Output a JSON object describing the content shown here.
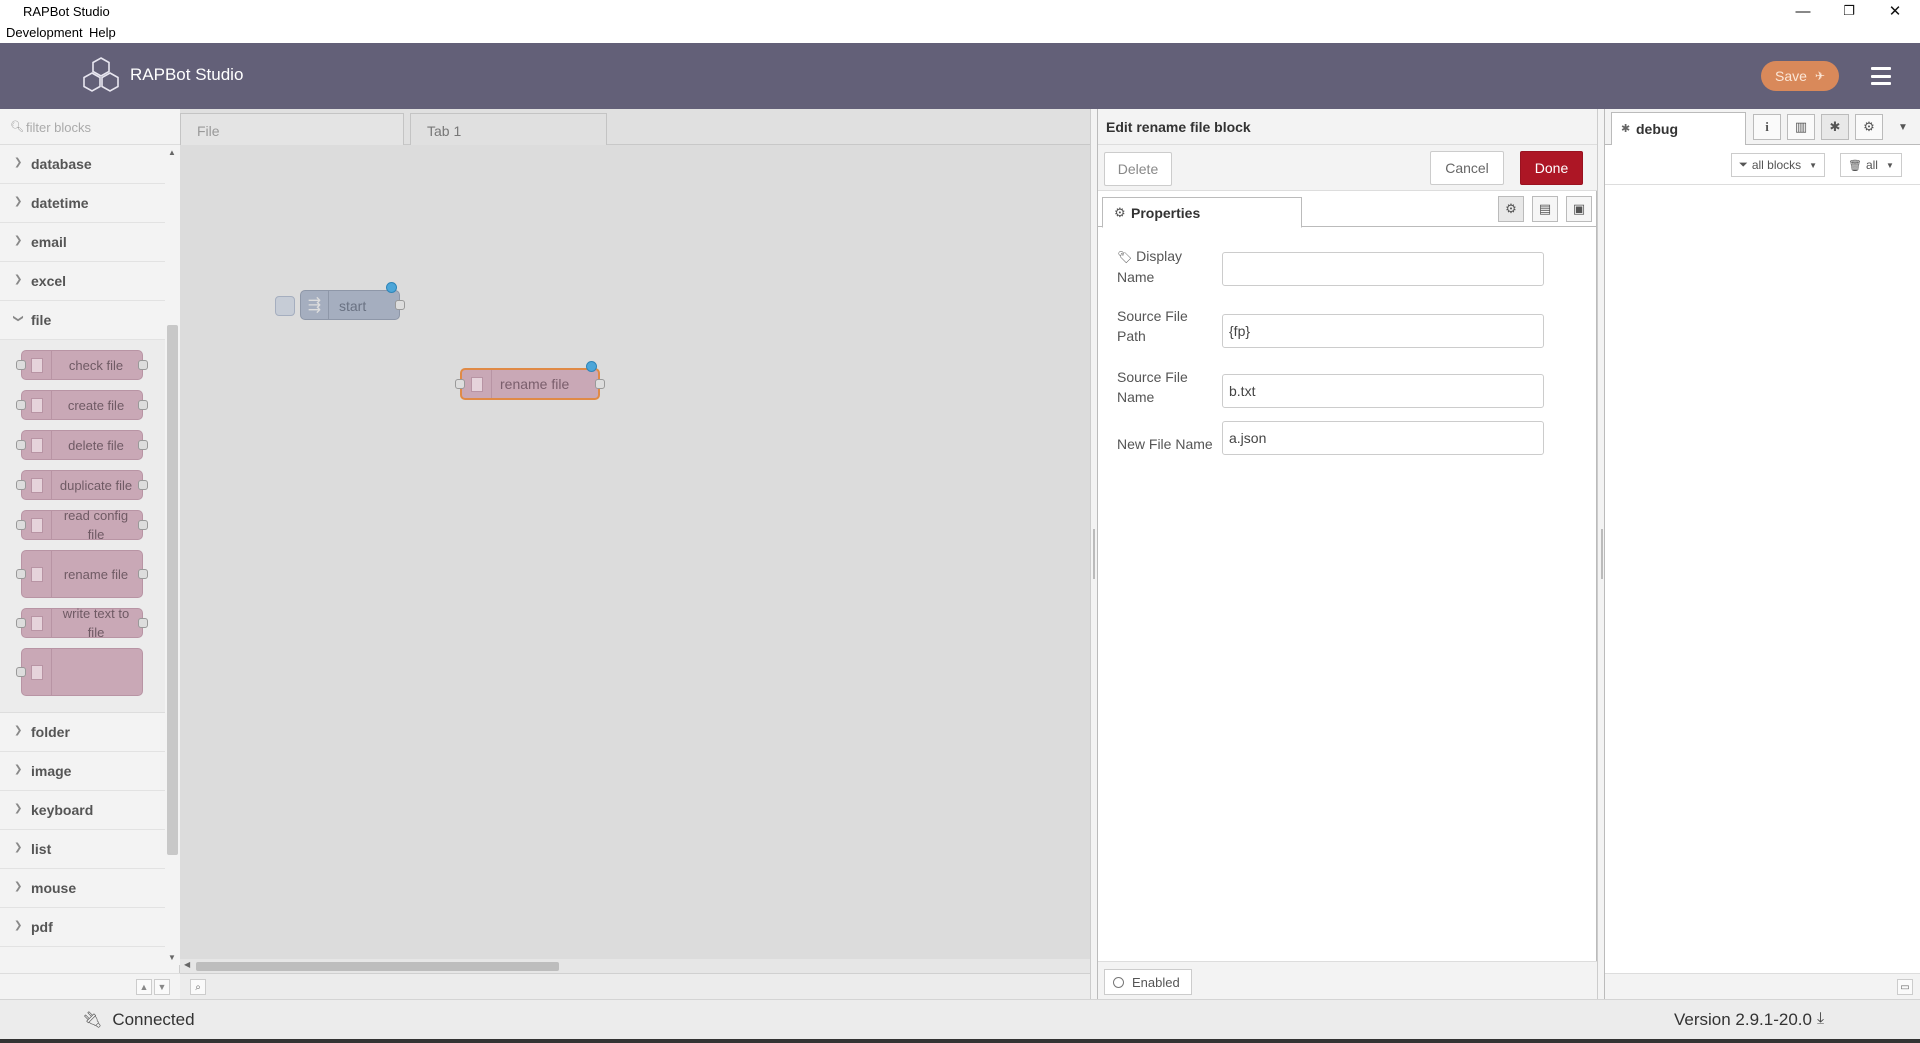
{
  "window": {
    "title": "RAPBot Studio",
    "minimize": "—",
    "restore": "❐",
    "close": "✕"
  },
  "menu": [
    "Development",
    "Help"
  ],
  "header": {
    "brand": "RAPBot Studio",
    "save_label": "Save",
    "colors": {
      "header_bg": "#636078",
      "save_bg": "#d9895a",
      "done_bg": "#ad1625"
    }
  },
  "palette": {
    "filter_placeholder": "filter blocks",
    "categories_before": [
      "database",
      "datetime",
      "email",
      "excel"
    ],
    "open_category": "file",
    "file_blocks": [
      "check file",
      "create file",
      "delete file",
      "duplicate file",
      "read config file",
      "rename file",
      "write text to file"
    ],
    "categories_after": [
      "folder",
      "image",
      "keyboard",
      "list",
      "mouse",
      "pdf"
    ]
  },
  "workspace": {
    "tabs": [
      "File",
      "Tab 1"
    ],
    "active_tab": "Tab 1",
    "nodes": {
      "start": "start",
      "rename": "rename file"
    }
  },
  "editor": {
    "title": "Edit rename file block",
    "delete_label": "Delete",
    "cancel_label": "Cancel",
    "done_label": "Done",
    "properties_tab": "Properties",
    "fields": {
      "display_name": {
        "label_line1": "Display",
        "label_line2": "Name",
        "value": ""
      },
      "source_path": {
        "label_line1": "Source File",
        "label_line2": "Path",
        "value": "{fp}"
      },
      "source_name": {
        "label_line1": "Source File",
        "label_line2": "Name",
        "value": "b.txt"
      },
      "new_name": {
        "label": "New File Name",
        "value": "a.json"
      }
    },
    "enabled_label": "Enabled"
  },
  "sidebar": {
    "debug_tab": "debug",
    "filter_dropdown": "all blocks",
    "clear_dropdown": "all"
  },
  "status": {
    "connection": "Connected",
    "version": "Version 2.9.1-20.0"
  }
}
